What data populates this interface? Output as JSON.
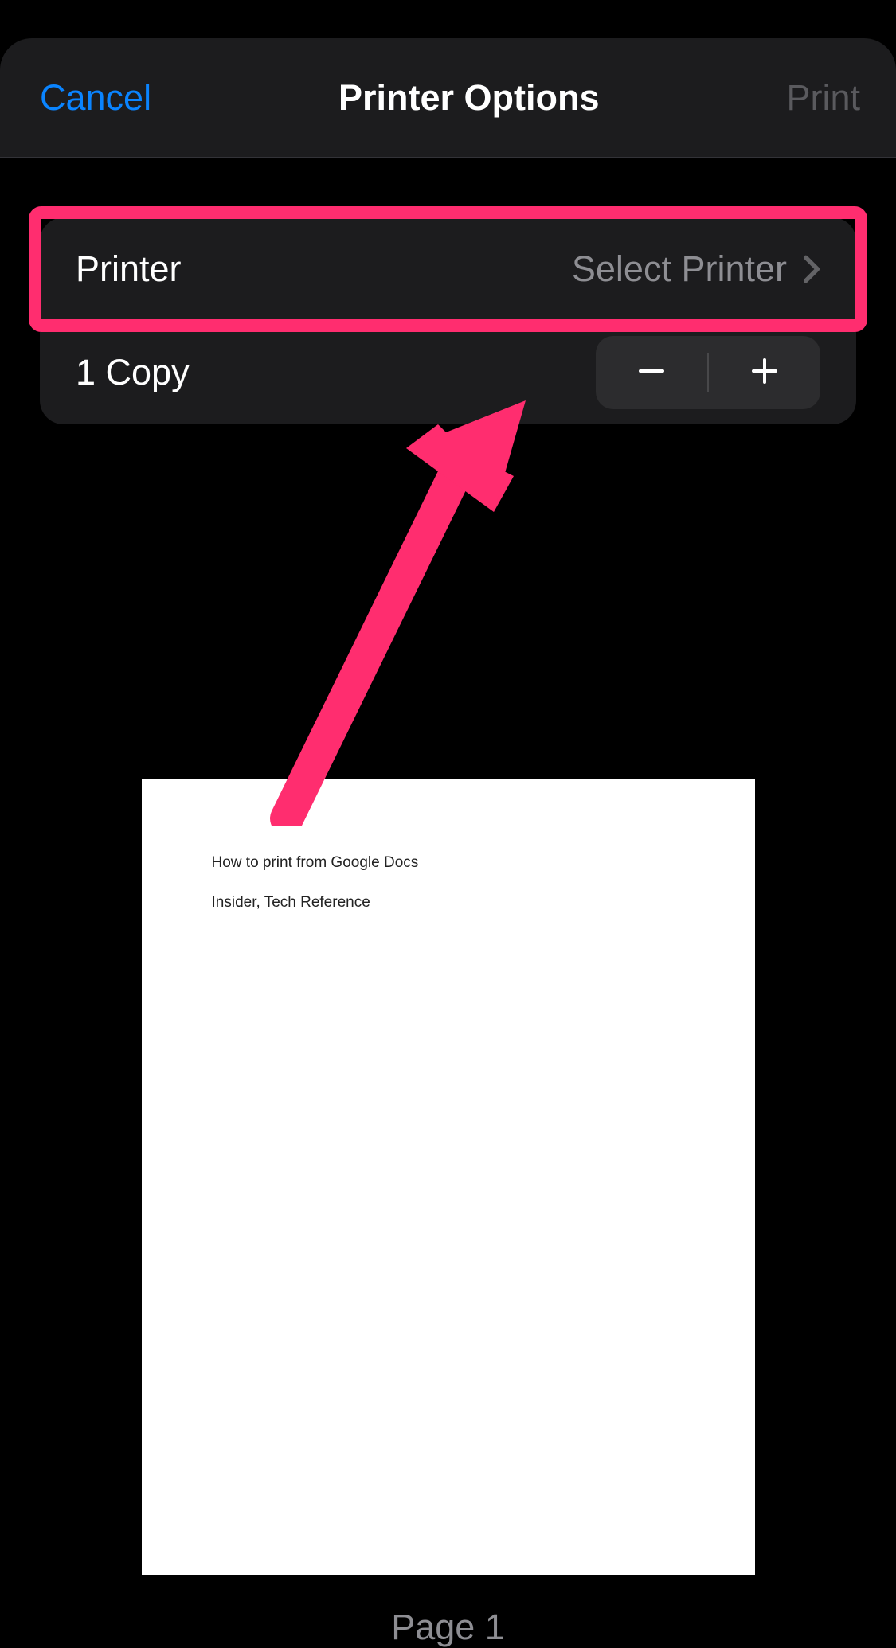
{
  "navbar": {
    "cancel_label": "Cancel",
    "title": "Printer Options",
    "print_label": "Print"
  },
  "settings": {
    "printer": {
      "label": "Printer",
      "value": "Select Printer"
    },
    "copies": {
      "label": "1 Copy"
    }
  },
  "preview": {
    "document": {
      "title": "How to print from Google Docs",
      "author": "Insider, Tech Reference"
    },
    "page_label": "Page 1"
  },
  "annotation": {
    "highlight_target": "printer-row",
    "color": "#ff2d6f"
  }
}
